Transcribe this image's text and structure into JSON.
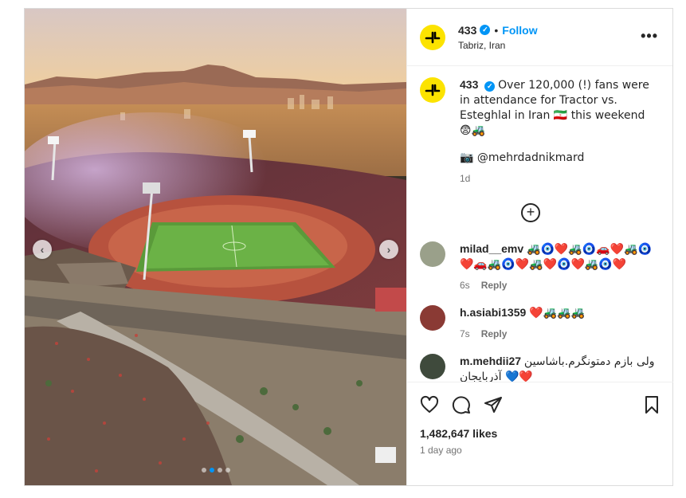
{
  "post": {
    "account": "433",
    "follow_label": "Follow",
    "dot_separator": "•",
    "location": "Tabriz, Iran",
    "more_label": "•••"
  },
  "caption": {
    "username": "433",
    "text": "Over 120,000 (!) fans were in attendance for Tractor vs. Esteghlal in Iran 🇮🇷 this weekend 😨🚜",
    "credit": "📷 @mehrdadnikmard",
    "time": "1d"
  },
  "load_more_label": "+",
  "comments": [
    {
      "username": "milad__emv",
      "text": "🚜🧿❤️🚜🧿🚗❤️🚜🧿 ❤️🚗🚜🧿❤️🚜❤️🧿❤️🚜🧿❤️",
      "time": "6s",
      "reply_label": "Reply",
      "avatar_color": "#9aa08a"
    },
    {
      "username": "h.asiabi1359",
      "text": "❤️🚜🚜🚜",
      "time": "7s",
      "reply_label": "Reply",
      "avatar_color": "#8a3a34"
    },
    {
      "username": "m.mehdii27",
      "text": "ولی بازم دمتونگرم.باشاسین آذربایجان 💙❤️",
      "avatar_color": "#3f4a3c"
    }
  ],
  "actions": {
    "likes": "1,482,647 likes",
    "posted": "1 day ago"
  },
  "carousel": {
    "prev_label": "‹",
    "next_label": "›",
    "slide_count": 4,
    "active_slide": 2
  },
  "colors": {
    "brand_yellow": "#fce300",
    "link_blue": "#0095f6",
    "muted": "#737373"
  }
}
